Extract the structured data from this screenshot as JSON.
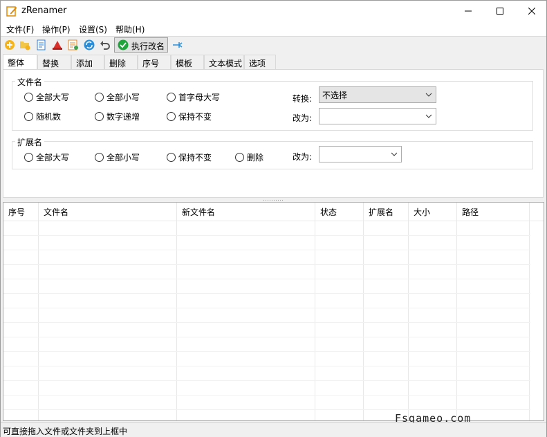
{
  "window": {
    "title": "zRenamer"
  },
  "menu": [
    "文件(F)",
    "操作(P)",
    "设置(S)",
    "帮助(H)"
  ],
  "toolbar": {
    "icons": [
      "add-file-icon",
      "add-folder-icon",
      "copy-list-icon",
      "clear-icon",
      "edit-list-icon",
      "refresh-icon",
      "undo-icon",
      "pin-icon"
    ],
    "execute_label": "执行改名"
  },
  "tabs": [
    "整体",
    "替换",
    "添加",
    "删除",
    "序号",
    "模板",
    "文本模式",
    "选项"
  ],
  "filename_group": {
    "title": "文件名",
    "options": [
      "全部大写",
      "全部小写",
      "首字母大写",
      "随机数",
      "数字递增",
      "保持不变"
    ],
    "convert_label": "转换:",
    "convert_value": "不选择",
    "change_label": "改为:",
    "change_value": ""
  },
  "ext_group": {
    "title": "扩展名",
    "options": [
      "全部大写",
      "全部小写",
      "保持不变",
      "删除"
    ],
    "change_label": "改为:",
    "change_value": ""
  },
  "grid": {
    "columns": [
      "序号",
      "文件名",
      "新文件名",
      "状态",
      "扩展名",
      "大小",
      "路径"
    ]
  },
  "status": {
    "text": "可直接拖入文件或文件夹到上框中"
  },
  "watermark": "Fsgameo.com"
}
